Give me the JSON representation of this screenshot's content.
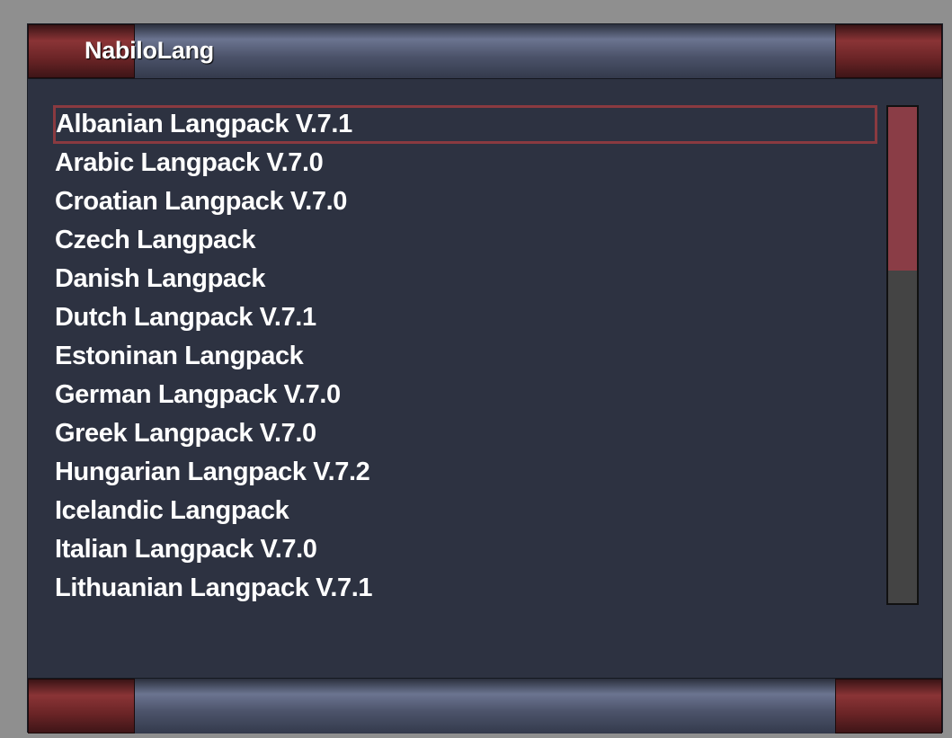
{
  "window": {
    "title": "NabiloLang"
  },
  "list": {
    "items": [
      {
        "label": "Albanian Langpack V.7.1",
        "selected": true
      },
      {
        "label": "Arabic Langpack V.7.0",
        "selected": false
      },
      {
        "label": "Croatian Langpack V.7.0",
        "selected": false
      },
      {
        "label": "Czech Langpack",
        "selected": false
      },
      {
        "label": "Danish Langpack",
        "selected": false
      },
      {
        "label": "Dutch Langpack V.7.1",
        "selected": false
      },
      {
        "label": "Estoninan Langpack",
        "selected": false
      },
      {
        "label": "German Langpack V.7.0",
        "selected": false
      },
      {
        "label": "Greek Langpack V.7.0",
        "selected": false
      },
      {
        "label": "Hungarian Langpack V.7.2",
        "selected": false
      },
      {
        "label": "Icelandic Langpack",
        "selected": false
      },
      {
        "label": "Italian Langpack V.7.0",
        "selected": false
      },
      {
        "label": "Lithuanian Langpack V.7.1",
        "selected": false
      }
    ]
  },
  "scrollbar": {
    "thumb_fraction": 0.33,
    "position_fraction": 0.0
  },
  "colors": {
    "background": "#2d3241",
    "accent": "#8a3a40",
    "text": "#ffffff"
  }
}
